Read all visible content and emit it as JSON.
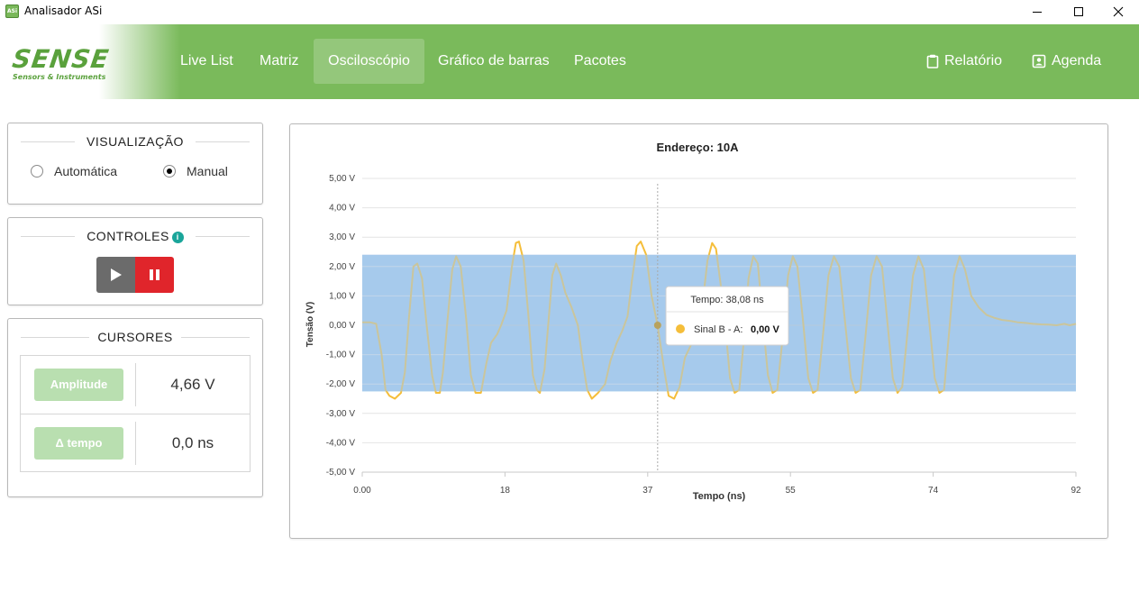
{
  "window": {
    "title": "Analisador ASi",
    "icon_text": "ASi"
  },
  "brand": {
    "name": "SENSE",
    "tagline": "Sensors & Instruments"
  },
  "nav": {
    "items": [
      {
        "label": "Live List",
        "active": false
      },
      {
        "label": "Matriz",
        "active": false
      },
      {
        "label": "Osciloscópio",
        "active": true
      },
      {
        "label": "Gráfico de barras",
        "active": false
      },
      {
        "label": "Pacotes",
        "active": false
      }
    ],
    "report_label": "Relatório",
    "agenda_label": "Agenda"
  },
  "visualizacao": {
    "title": "VISUALIZAÇÃO",
    "options": [
      {
        "label": "Automática",
        "selected": false
      },
      {
        "label": "Manual",
        "selected": true
      }
    ]
  },
  "controles": {
    "title": "CONTROLES",
    "info_icon": "i"
  },
  "cursores": {
    "title": "CURSORES",
    "rows": [
      {
        "button": "Amplitude",
        "value": "4,66 V"
      },
      {
        "button": "Δ tempo",
        "value": "0,0 ns"
      }
    ]
  },
  "chart_data": {
    "type": "line",
    "title": "Endereço: 10A",
    "xlabel": "Tempo (ns)",
    "ylabel": "Tensão (V)",
    "xlim": [
      0,
      92
    ],
    "ylim": [
      -5,
      5
    ],
    "x_tick_labels": [
      "0.00",
      "18",
      "37",
      "55",
      "74",
      "92"
    ],
    "x_tick_values": [
      0,
      18.4,
      36.8,
      55.2,
      73.6,
      92
    ],
    "y_tick_labels": [
      "5,00 V",
      "4,00 V",
      "3,00 V",
      "2,00 V",
      "1,00 V",
      "0,00 V",
      "-1,00 V",
      "-2,00 V",
      "-3,00 V",
      "-4,00 V",
      "-5,00 V"
    ],
    "y_tick_values": [
      5,
      4,
      3,
      2,
      1,
      0,
      -1,
      -2,
      -3,
      -4,
      -5
    ],
    "band": {
      "from": -2.25,
      "to": 2.4,
      "color": "#a6cbec"
    },
    "series": [
      {
        "name": "Sinal B - A",
        "color": "#f5be3a",
        "points": [
          [
            0,
            0.1
          ],
          [
            1,
            0.1
          ],
          [
            1.8,
            0.05
          ],
          [
            2.5,
            -1.0
          ],
          [
            3,
            -2.2
          ],
          [
            3.5,
            -2.4
          ],
          [
            4.2,
            -2.5
          ],
          [
            5,
            -2.3
          ],
          [
            5.5,
            -1.6
          ],
          [
            6,
            0.2
          ],
          [
            6.6,
            2.0
          ],
          [
            7.1,
            2.1
          ],
          [
            7.7,
            1.6
          ],
          [
            8.3,
            0
          ],
          [
            9,
            -1.7
          ],
          [
            9.5,
            -2.3
          ],
          [
            10,
            -2.3
          ],
          [
            10.4,
            -1.6
          ],
          [
            11,
            0.2
          ],
          [
            11.6,
            1.9
          ],
          [
            12.1,
            2.35
          ],
          [
            12.7,
            2.0
          ],
          [
            13.4,
            0.2
          ],
          [
            14,
            -1.7
          ],
          [
            14.6,
            -2.3
          ],
          [
            15.3,
            -2.3
          ],
          [
            16,
            -1.3
          ],
          [
            16.6,
            -0.6
          ],
          [
            17.4,
            -0.3
          ],
          [
            17.9,
            0
          ],
          [
            18.6,
            0.5
          ],
          [
            19.3,
            2.0
          ],
          [
            19.8,
            2.8
          ],
          [
            20.2,
            2.85
          ],
          [
            20.8,
            2.2
          ],
          [
            21.4,
            0.4
          ],
          [
            22,
            -1.7
          ],
          [
            22.5,
            -2.2
          ],
          [
            22.9,
            -2.3
          ],
          [
            23.5,
            -1.5
          ],
          [
            24,
            0.1
          ],
          [
            24.5,
            1.7
          ],
          [
            25,
            2.1
          ],
          [
            25.6,
            1.7
          ],
          [
            26.2,
            1.1
          ],
          [
            27,
            0.6
          ],
          [
            27.8,
            0
          ],
          [
            28.4,
            -1.2
          ],
          [
            29,
            -2.2
          ],
          [
            29.6,
            -2.5
          ],
          [
            30.4,
            -2.3
          ],
          [
            31.3,
            -2.0
          ],
          [
            32,
            -1.2
          ],
          [
            32.8,
            -0.6
          ],
          [
            33.5,
            -0.2
          ],
          [
            34.2,
            0.3
          ],
          [
            34.8,
            1.6
          ],
          [
            35.4,
            2.7
          ],
          [
            35.9,
            2.85
          ],
          [
            36.6,
            2.4
          ],
          [
            37.3,
            1.0
          ],
          [
            38.08,
            0
          ],
          [
            38.8,
            -1.3
          ],
          [
            39.5,
            -2.4
          ],
          [
            40.2,
            -2.5
          ],
          [
            40.9,
            -2.1
          ],
          [
            41.6,
            -1.1
          ],
          [
            42.5,
            -0.6
          ],
          [
            43.3,
            -0.1
          ],
          [
            43.9,
            0.8
          ],
          [
            44.5,
            2.2
          ],
          [
            45.1,
            2.8
          ],
          [
            45.6,
            2.6
          ],
          [
            46.2,
            1.4
          ],
          [
            46.8,
            0
          ],
          [
            47.4,
            -1.8
          ],
          [
            48,
            -2.3
          ],
          [
            48.6,
            -2.2
          ],
          [
            49.2,
            -0.5
          ],
          [
            49.8,
            1.6
          ],
          [
            50.4,
            2.35
          ],
          [
            51,
            2.1
          ],
          [
            51.6,
            0.3
          ],
          [
            52.3,
            -1.7
          ],
          [
            52.9,
            -2.3
          ],
          [
            53.5,
            -2.2
          ],
          [
            54.2,
            -0.4
          ],
          [
            54.9,
            1.7
          ],
          [
            55.5,
            2.35
          ],
          [
            56.1,
            2.0
          ],
          [
            56.8,
            0.2
          ],
          [
            57.5,
            -1.8
          ],
          [
            58.1,
            -2.3
          ],
          [
            58.7,
            -2.2
          ],
          [
            59.4,
            -0.3
          ],
          [
            60.1,
            1.7
          ],
          [
            60.8,
            2.35
          ],
          [
            61.5,
            2.0
          ],
          [
            62.2,
            0.2
          ],
          [
            63,
            -1.8
          ],
          [
            63.6,
            -2.3
          ],
          [
            64.2,
            -2.2
          ],
          [
            64.9,
            -0.3
          ],
          [
            65.6,
            1.7
          ],
          [
            66.3,
            2.35
          ],
          [
            67,
            2.0
          ],
          [
            67.7,
            0.1
          ],
          [
            68.4,
            -1.8
          ],
          [
            69,
            -2.3
          ],
          [
            69.6,
            -2.1
          ],
          [
            70.3,
            -0.2
          ],
          [
            71,
            1.7
          ],
          [
            71.7,
            2.35
          ],
          [
            72.4,
            1.9
          ],
          [
            73.1,
            0.1
          ],
          [
            73.8,
            -1.8
          ],
          [
            74.4,
            -2.3
          ],
          [
            75,
            -2.2
          ],
          [
            75.6,
            -0.4
          ],
          [
            76.3,
            1.7
          ],
          [
            77,
            2.35
          ],
          [
            77.7,
            1.9
          ],
          [
            78.5,
            1.0
          ],
          [
            79.5,
            0.6
          ],
          [
            80.5,
            0.35
          ],
          [
            81.5,
            0.25
          ],
          [
            82.5,
            0.18
          ],
          [
            83.5,
            0.15
          ],
          [
            84.5,
            0.1
          ],
          [
            85.5,
            0.08
          ],
          [
            86.5,
            0.05
          ],
          [
            87.5,
            0.03
          ],
          [
            88.5,
            0.02
          ],
          [
            89.5,
            0.0
          ],
          [
            90.5,
            0.05
          ],
          [
            91.2,
            0.0
          ],
          [
            92,
            0.05
          ]
        ]
      }
    ],
    "cursor": {
      "x": 38.08,
      "y": 0.0
    },
    "tooltip": {
      "header": "Tempo: 38,08 ns",
      "series_label": "Sinal B - A:",
      "value": "0,00 V"
    }
  }
}
